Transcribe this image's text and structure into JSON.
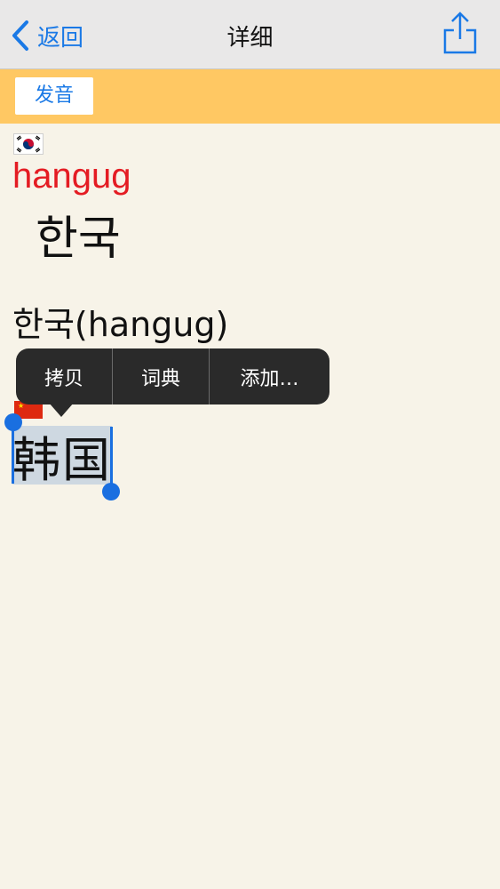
{
  "navbar": {
    "back_label": "返回",
    "title": "详细",
    "back_icon": "chevron-left-icon",
    "share_icon": "share-icon"
  },
  "toolbar": {
    "pronounce_label": "发音"
  },
  "entry": {
    "source_flag_icon": "south-korea-flag-icon",
    "romanization": "hangug",
    "korean_word": "한국",
    "korean_with_romanization": "한국(hangug)",
    "target_flag_icon": "china-flag-icon",
    "chinese_translation": "韩国"
  },
  "context_menu": {
    "items": [
      "拷贝",
      "词典",
      "添加…"
    ]
  },
  "colors": {
    "accent": "#1a79e6",
    "toolbar_bg": "#ffc863",
    "romanization": "#e41c23",
    "background": "#f7f3e8",
    "selection_handle": "#1a6fe0",
    "menu_bg": "#2a2a2a"
  }
}
